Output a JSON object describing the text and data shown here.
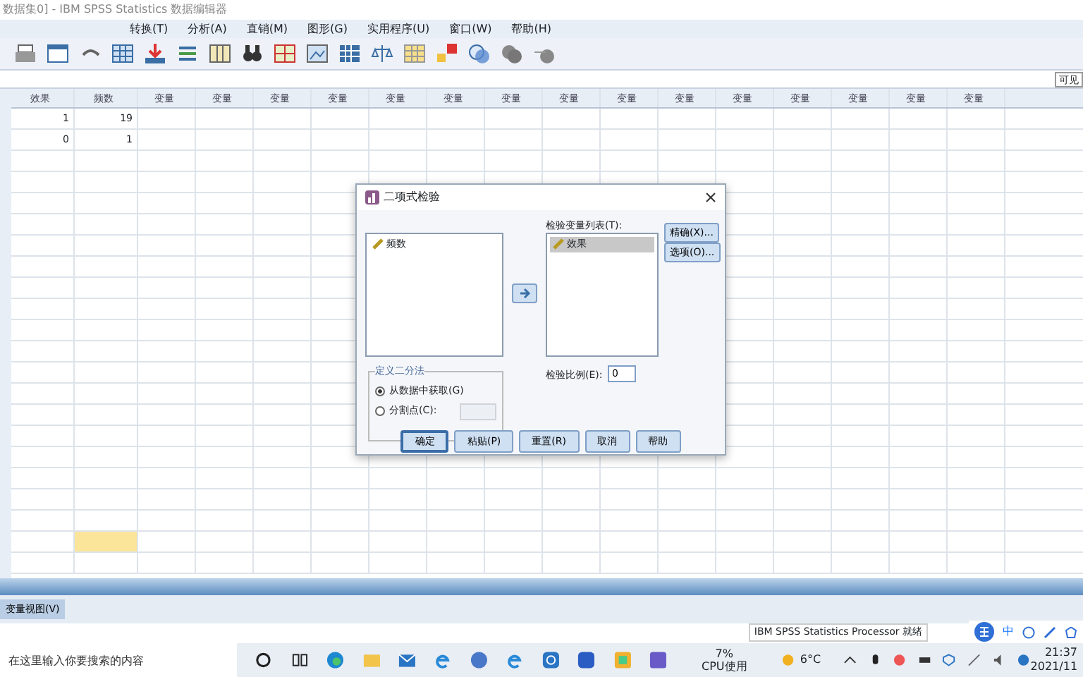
{
  "window": {
    "title": "数据集0] - IBM SPSS Statistics 数据编辑器"
  },
  "menu": [
    "转换(T)",
    "分析(A)",
    "直销(M)",
    "图形(G)",
    "实用程序(U)",
    "窗口(W)",
    "帮助(H)"
  ],
  "formula_bar": {
    "visible_label": "可见"
  },
  "grid": {
    "columns": [
      "效果",
      "频数",
      "变量",
      "变量",
      "变量",
      "变量",
      "变量",
      "变量",
      "变量",
      "变量",
      "变量",
      "变量",
      "变量",
      "变量",
      "变量",
      "变量",
      "变量"
    ],
    "rows": [
      {
        "cells": [
          {
            "text": "1",
            "selected": false
          },
          {
            "text": "19",
            "selected": false
          }
        ]
      },
      {
        "cells": [
          {
            "text": "0",
            "selected": false
          },
          {
            "text": "1",
            "selected": false
          }
        ]
      },
      {
        "cells": [
          {
            "selected": false
          },
          {
            "selected": false
          }
        ]
      },
      {
        "cells": [
          {
            "selected": false
          },
          {
            "selected": false
          }
        ]
      },
      {
        "cells": [
          {
            "selected": false
          },
          {
            "selected": false
          }
        ]
      },
      {
        "cells": [
          {
            "selected": false
          },
          {
            "selected": false
          }
        ]
      },
      {
        "cells": [
          {
            "selected": false
          },
          {
            "selected": false
          }
        ]
      },
      {
        "cells": [
          {
            "selected": false
          },
          {
            "selected": false
          }
        ]
      },
      {
        "cells": [
          {
            "selected": false
          },
          {
            "selected": false
          }
        ]
      },
      {
        "cells": [
          {
            "selected": false
          },
          {
            "selected": false
          }
        ]
      },
      {
        "cells": [
          {
            "selected": false
          },
          {
            "selected": false
          }
        ]
      },
      {
        "cells": [
          {
            "selected": false
          },
          {
            "selected": false
          }
        ]
      },
      {
        "cells": [
          {
            "selected": false
          },
          {
            "selected": false
          }
        ]
      },
      {
        "cells": [
          {
            "selected": false
          },
          {
            "selected": false
          }
        ]
      },
      {
        "cells": [
          {
            "selected": false
          },
          {
            "selected": false
          }
        ]
      },
      {
        "cells": [
          {
            "selected": false
          },
          {
            "selected": false
          }
        ]
      },
      {
        "cells": [
          {
            "selected": false
          },
          {
            "selected": false
          }
        ]
      },
      {
        "cells": [
          {
            "selected": false
          },
          {
            "selected": false
          }
        ]
      },
      {
        "cells": [
          {
            "selected": false
          },
          {
            "selected": false
          }
        ]
      },
      {
        "cells": [
          {
            "selected": false
          },
          {
            "selected": false
          }
        ]
      },
      {
        "cells": [
          {
            "selected": false
          },
          {
            "selected": true
          }
        ]
      },
      {
        "cells": [
          {
            "selected": false
          },
          {
            "selected": false
          }
        ]
      }
    ]
  },
  "view_tabs": [
    {
      "label": "变量视图(V)",
      "selected": false
    }
  ],
  "status_bar": {
    "text": "IBM SPSS Statistics Processor 就绪"
  },
  "dialog": {
    "title": "二项式检验",
    "source_list": [
      {
        "label": "频数",
        "selected": false
      }
    ],
    "target_label": "检验变量列表(T):",
    "target_list": [
      {
        "label": "效果",
        "selected": true
      }
    ],
    "side_buttons": [
      "精确(X)...",
      "选项(O)..."
    ],
    "dichotomy": {
      "title": "定义二分法",
      "options": [
        {
          "label": "从数据中获取(G)",
          "selected": true
        },
        {
          "label": "分割点(C):",
          "selected": false
        }
      ],
      "cut_point_disabled": true
    },
    "test_proportion": {
      "label": "检验比例(E):",
      "value": "0"
    },
    "buttons": [
      {
        "label": "确定",
        "default": true
      },
      {
        "label": "粘贴(P)",
        "default": false
      },
      {
        "label": "重置(R)",
        "default": false
      },
      {
        "label": "取消",
        "default": false
      },
      {
        "label": "帮助",
        "default": false
      }
    ]
  },
  "taskbar": {
    "search": {
      "placeholder": "在这里输入你要搜索的内容"
    },
    "cpu": {
      "value": "7%",
      "label": "CPU使用"
    },
    "weather": "6°C",
    "time": "21:37",
    "date": "2021/11",
    "ime": "中"
  }
}
